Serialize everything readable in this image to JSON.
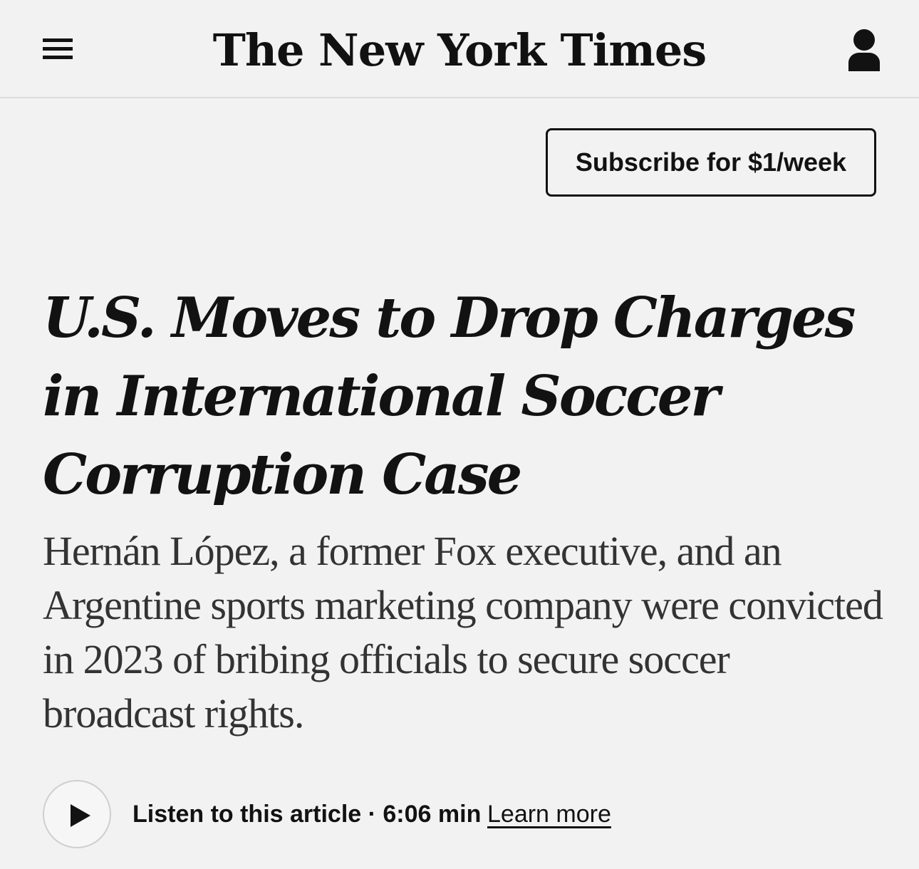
{
  "header": {
    "logo_text": "The New York Times",
    "menu_icon": "hamburger-menu-icon",
    "account_icon": "account-icon"
  },
  "subscribe": {
    "label": "Subscribe for $1/week"
  },
  "article": {
    "headline": "U.S. Moves to Drop Charges in International Soccer Corruption Case",
    "summary": "Hernán López, a former Fox executive, and an Argentine sports marketing company were convicted in 2023 of bribing officials to secure soccer broadcast rights."
  },
  "audio": {
    "play_icon": "play-icon",
    "listen_label": "Listen to this article · 6:06 min",
    "learn_more_label": "Learn more"
  },
  "colors": {
    "background": "#f2f2f2",
    "text": "#121212",
    "summary_text": "#333333",
    "divider": "#dcdcdc"
  }
}
